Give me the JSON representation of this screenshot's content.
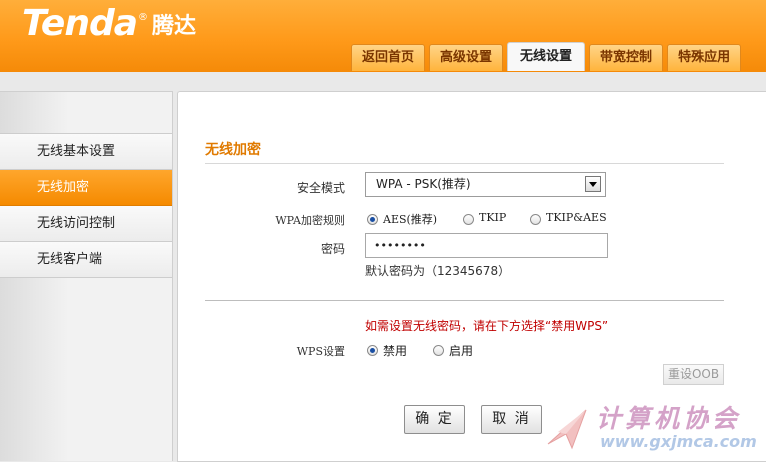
{
  "header": {
    "logo_en": "Tenda",
    "logo_reg": "®",
    "logo_cn": "腾达",
    "tabs": [
      {
        "label": "返回首页",
        "active": false
      },
      {
        "label": "高级设置",
        "active": false
      },
      {
        "label": "无线设置",
        "active": true
      },
      {
        "label": "带宽控制",
        "active": false
      },
      {
        "label": "特殊应用",
        "active": false
      }
    ]
  },
  "sidebar": {
    "items": [
      {
        "label": "无线基本设置",
        "active": false
      },
      {
        "label": "无线加密",
        "active": true
      },
      {
        "label": "无线访问控制",
        "active": false
      },
      {
        "label": "无线客户端",
        "active": false
      }
    ]
  },
  "content": {
    "section_title": "无线加密",
    "security_mode": {
      "label": "安全模式",
      "value": "WPA - PSK(推荐)"
    },
    "wpa_rule": {
      "label": "WPA加密规则",
      "options": [
        {
          "label": "AES(推荐)",
          "checked": true
        },
        {
          "label": "TKIP",
          "checked": false
        },
        {
          "label": "TKIP&AES",
          "checked": false
        }
      ]
    },
    "password": {
      "label": "密码",
      "value": "••••••••",
      "hint": "默认密码为（12345678）"
    },
    "wps_warning": "如需设置无线密码，请在下方选择“禁用WPS”",
    "wps": {
      "label": "WPS设置",
      "options": [
        {
          "label": "禁用",
          "checked": true
        },
        {
          "label": "启用",
          "checked": false
        }
      ]
    },
    "reset_oob_label": "重设OOB",
    "ok_label": "确 定",
    "cancel_label": "取 消"
  },
  "watermark": {
    "title": "计算机协会",
    "url": "www.gxjmca.com"
  },
  "colors": {
    "brand_orange": "#ff9a1a",
    "active_tab_bg": "#f8f8f8",
    "section_title": "#e07a00",
    "warning": "#c00000"
  }
}
